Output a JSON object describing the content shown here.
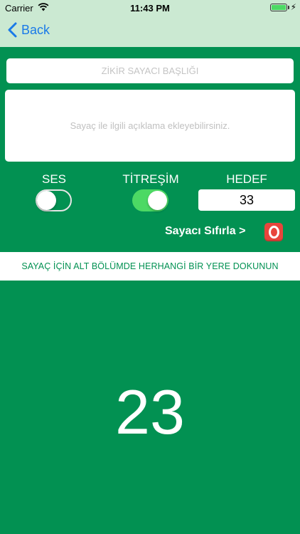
{
  "status_bar": {
    "carrier": "Carrier",
    "time": "11:43 PM"
  },
  "nav": {
    "back_label": "Back"
  },
  "form": {
    "title_placeholder": "ZİKİR SAYACI BAŞLIĞI",
    "description_placeholder": "Sayaç ile ilgili açıklama ekleyebilirsiniz."
  },
  "settings": {
    "sound_label": "SES",
    "sound_on": false,
    "vibration_label": "TİTREŞİM",
    "vibration_on": true,
    "target_label": "HEDEF",
    "target_value": "33"
  },
  "reset": {
    "label": "Sayacı Sıfırla >"
  },
  "banner": {
    "text": "SAYAÇ İÇİN ALT BÖLÜMDE HERHANGİ BİR YERE DOKUNUN"
  },
  "counter": {
    "value": "23"
  },
  "colors": {
    "background": "#029152",
    "nav_bar": "#cbe9d2",
    "link": "#1a7ae8",
    "toggle_on": "#4cd964",
    "reset_icon": "#e8453c"
  }
}
